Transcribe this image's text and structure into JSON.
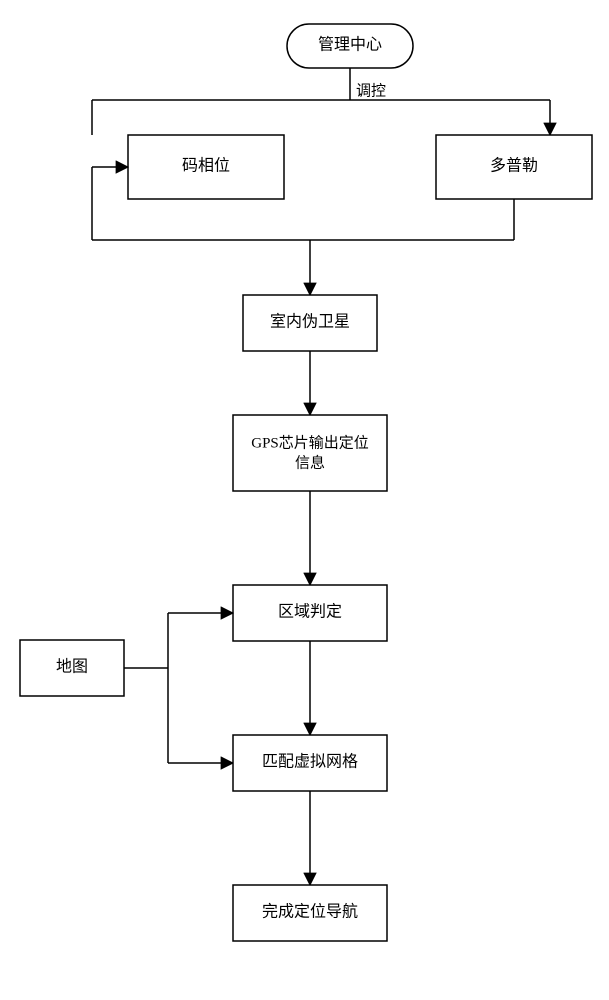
{
  "chart_data": {
    "type": "flowchart",
    "nodes": {
      "management_center": {
        "label": "管理中心",
        "shape": "rounded"
      },
      "code_phase": {
        "label": "码相位",
        "shape": "rect"
      },
      "doppler": {
        "label": "多普勒",
        "shape": "rect"
      },
      "indoor_pseudolite": {
        "label": "室内伪卫星",
        "shape": "rect"
      },
      "gps_output_l1": {
        "label": "GPS芯片输出定位"
      },
      "gps_output_l2": {
        "label": "信息"
      },
      "area_decision": {
        "label": "区域判定",
        "shape": "rect"
      },
      "map": {
        "label": "地图",
        "shape": "rect"
      },
      "match_grid": {
        "label": "匹配虚拟网格",
        "shape": "rect"
      },
      "complete_nav": {
        "label": "完成定位导航",
        "shape": "rect"
      }
    },
    "edges": [
      {
        "from": "management_center",
        "to": "code_phase",
        "label": "调控"
      },
      {
        "from": "management_center",
        "to": "doppler",
        "label": "调控"
      },
      {
        "from": "code_phase",
        "to": "indoor_pseudolite"
      },
      {
        "from": "doppler",
        "to": "indoor_pseudolite"
      },
      {
        "from": "indoor_pseudolite",
        "to": "gps_output"
      },
      {
        "from": "gps_output",
        "to": "area_decision"
      },
      {
        "from": "area_decision",
        "to": "match_grid"
      },
      {
        "from": "map",
        "to": "area_decision"
      },
      {
        "from": "map",
        "to": "match_grid"
      },
      {
        "from": "match_grid",
        "to": "complete_nav"
      }
    ]
  }
}
